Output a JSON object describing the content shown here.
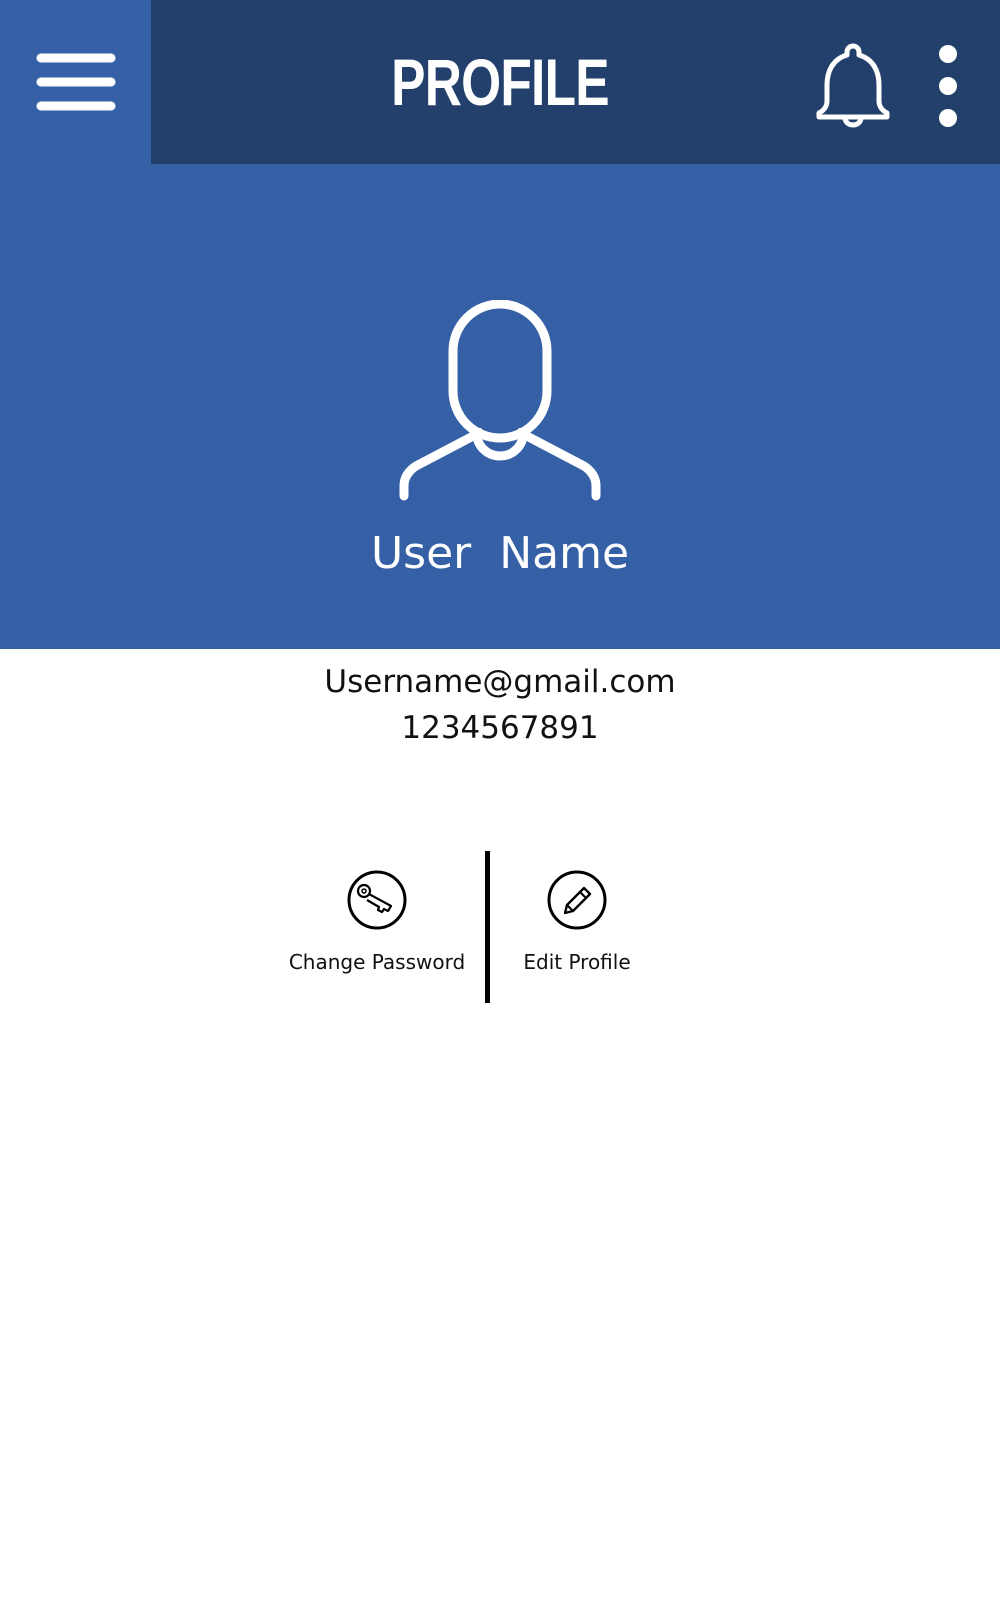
{
  "header": {
    "title": "PROFILE",
    "menu_icon": "hamburger-menu-icon",
    "notification_icon": "bell-icon",
    "more_icon": "more-vertical-icon"
  },
  "profile": {
    "avatar_icon": "user-avatar-icon",
    "name": "User  Name",
    "email": "Username@gmail.com",
    "phone": "1234567891"
  },
  "actions": [
    {
      "label": "Change Password",
      "icon": "key-icon"
    },
    {
      "label": "Edit Profile",
      "icon": "pencil-icon"
    }
  ],
  "colors": {
    "header_dark": "#233f6b",
    "primary_blue": "#3560a6",
    "text": "#111111",
    "background": "#ffffff"
  }
}
